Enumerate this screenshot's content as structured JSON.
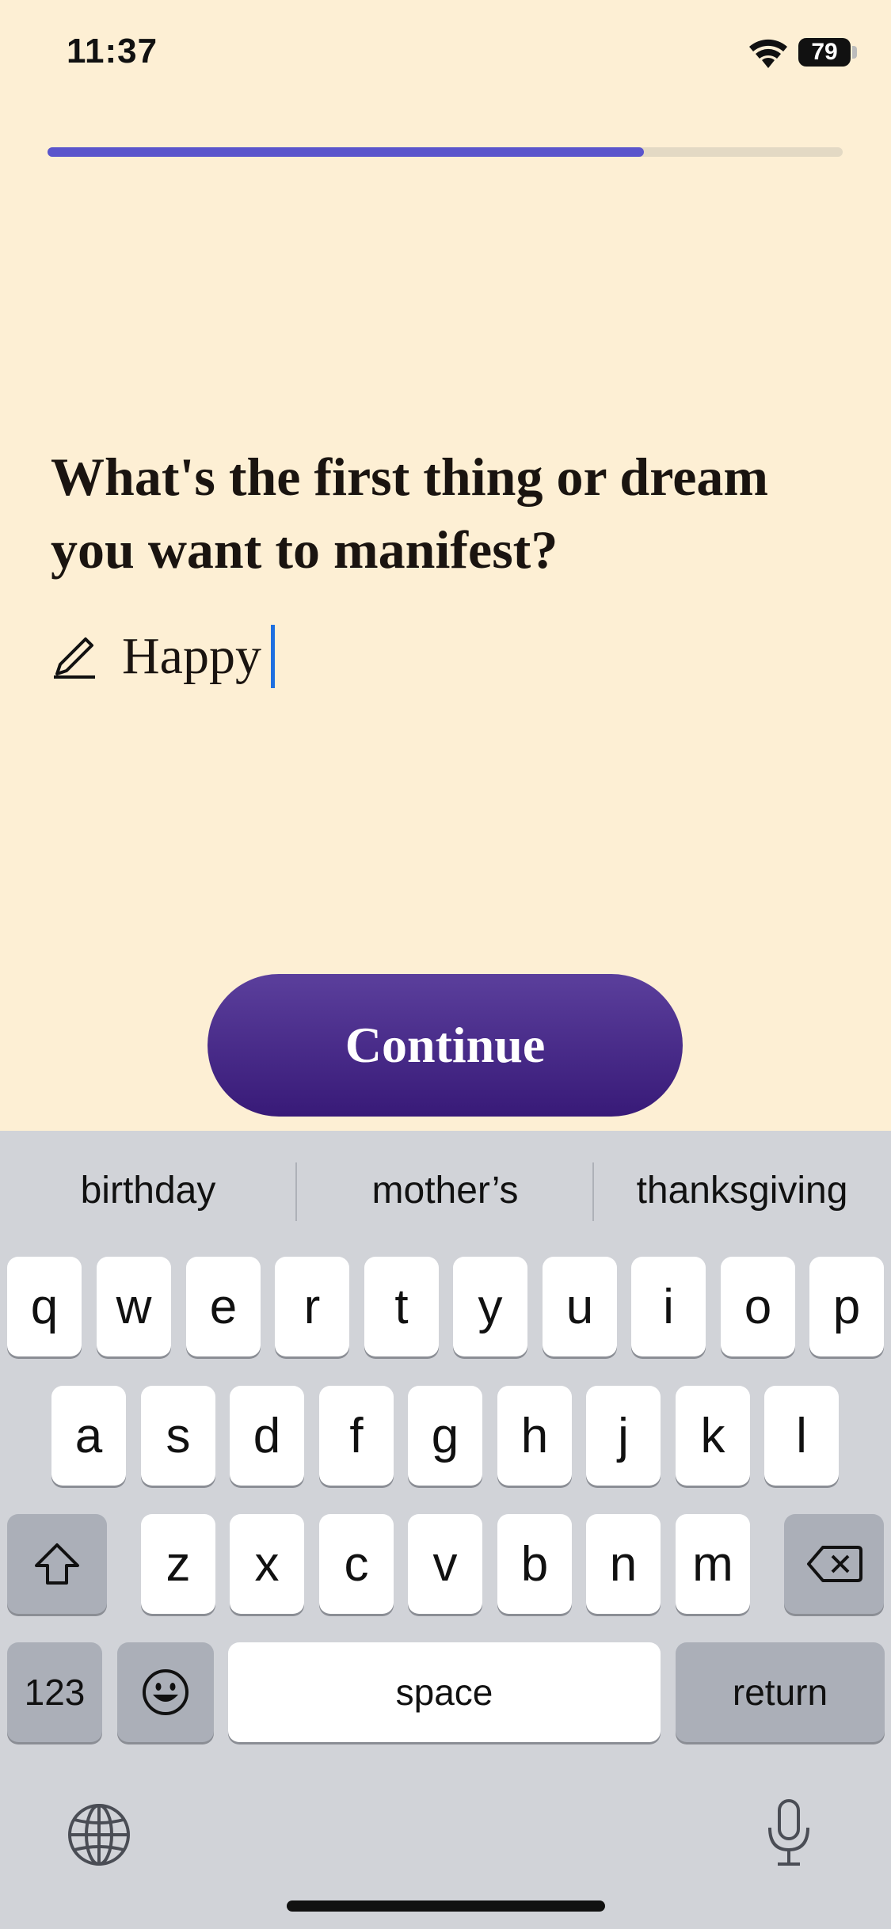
{
  "status": {
    "time": "11:37",
    "battery": "79"
  },
  "progress": {
    "fraction": 0.75
  },
  "question": {
    "title": "What's the first thing or dream you want to manifest?"
  },
  "answer": {
    "value": "Happy"
  },
  "continue_label": "Continue",
  "keyboard": {
    "suggestions": [
      "birthday",
      "mother’s",
      "thanksgiving"
    ],
    "row1": [
      "q",
      "w",
      "e",
      "r",
      "t",
      "y",
      "u",
      "i",
      "o",
      "p"
    ],
    "row2": [
      "a",
      "s",
      "d",
      "f",
      "g",
      "h",
      "j",
      "k",
      "l"
    ],
    "row3": [
      "z",
      "x",
      "c",
      "v",
      "b",
      "n",
      "m"
    ],
    "numbers_label": "123",
    "space_label": "space",
    "return_label": "return"
  },
  "colors": {
    "background": "#fdefd4",
    "accent": "#5a55cc",
    "button": "#4a2b8a"
  },
  "icons": [
    "wifi-icon",
    "battery-icon",
    "pencil-icon",
    "shift-icon",
    "delete-icon",
    "emoji-icon",
    "globe-icon",
    "microphone-icon"
  ]
}
